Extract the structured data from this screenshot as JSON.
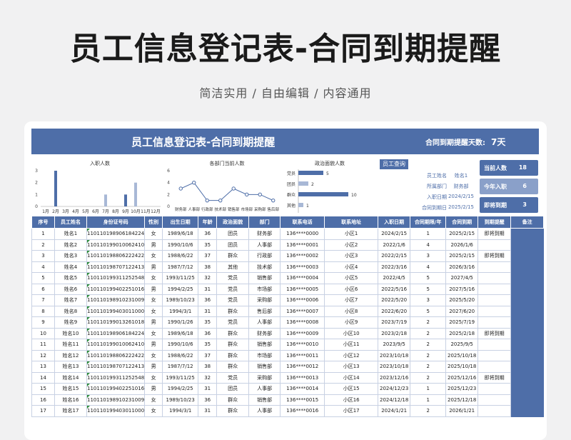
{
  "header": {
    "title": "员工信息登记表-合同到期提醒",
    "subtitle": "简洁实用 / 自由编辑 / 内容通用"
  },
  "sheet": {
    "title": "员工信息登记表-合同到期提醒",
    "reminder_label": "合同到期提醒天数:",
    "reminder_days": "7天"
  },
  "colors": {
    "accent": "#4e6ea8",
    "light_accent": "#8aa0c9",
    "bar_light": "#a8b8d6"
  },
  "chart_data": [
    {
      "type": "bar",
      "title": "入职人数",
      "categories": [
        "1月",
        "2月",
        "3月",
        "4月",
        "5月",
        "6月",
        "7月",
        "8月",
        "9月",
        "10月",
        "11月",
        "12月"
      ],
      "values": [
        0,
        3,
        0,
        0,
        0,
        0,
        1,
        0,
        1,
        2,
        0,
        0
      ],
      "ylim": [
        0,
        3
      ],
      "yticks": [
        "0",
        "1",
        "2",
        "3"
      ]
    },
    {
      "type": "line",
      "title": "各部门当前人数",
      "categories": [
        "财务部",
        "人事部",
        "行政部",
        "技术部",
        "销售部",
        "市场部",
        "采购部",
        "售后部"
      ],
      "values": [
        3,
        4,
        1,
        1,
        3,
        2,
        2,
        1
      ],
      "ylim": [
        0,
        6
      ],
      "yticks": [
        "0",
        "2",
        "4",
        "6"
      ]
    },
    {
      "type": "bar",
      "orientation": "horizontal",
      "title": "政治面貌人数",
      "categories": [
        "党员",
        "团员",
        "群众",
        "其他"
      ],
      "values": [
        5,
        2,
        10,
        1
      ]
    }
  ],
  "query": {
    "button": "员工查询",
    "rows": [
      {
        "label": "员工姓名",
        "value": "姓名1"
      },
      {
        "label": "所属部门",
        "value": "财务部"
      },
      {
        "label": "入职日期",
        "value": "2024/2/15"
      },
      {
        "label": "合同到期日",
        "value": "2025/2/15"
      }
    ]
  },
  "stats": [
    {
      "label": "当前人数",
      "value": "18"
    },
    {
      "label": "今年入职",
      "value": "6"
    },
    {
      "label": "即将到期",
      "value": "3"
    }
  ],
  "table": {
    "headers": [
      "序号",
      "员工姓名",
      "身份证号码",
      "性别",
      "出生日期",
      "年龄",
      "政治面貌",
      "部门",
      "联系电话",
      "联系地址",
      "入职日期",
      "合同期限/年",
      "合同到期",
      "到期提醒",
      "备注"
    ],
    "rows": [
      [
        "1",
        "姓名1",
        "11011019890618​4224",
        "女",
        "1989/6/18",
        "36",
        "团员",
        "财务部",
        "136****0000",
        "小区1",
        "2024/2/15",
        "1",
        "2025/2/15",
        "即将到期",
        ""
      ],
      [
        "2",
        "姓名2",
        "11011019901006​2410",
        "男",
        "1990/10/6",
        "35",
        "团员",
        "人事部",
        "136****0001",
        "小区2",
        "2022/1/6",
        "4",
        "2026/1/6",
        "",
        ""
      ],
      [
        "3",
        "姓名3",
        "11011019880622​2422",
        "女",
        "1988/6/22",
        "37",
        "群众",
        "行政部",
        "136****0002",
        "小区3",
        "2022/2/15",
        "3",
        "2025/2/15",
        "即将到期",
        ""
      ],
      [
        "4",
        "姓名4",
        "11011019870712​2413",
        "男",
        "1987/7/12",
        "38",
        "其他",
        "技术部",
        "136****0003",
        "小区4",
        "2022/3/16",
        "4",
        "2026/3/16",
        "",
        ""
      ],
      [
        "5",
        "姓名5",
        "11011019931125​2548",
        "女",
        "1993/11/25",
        "32",
        "党员",
        "销售部",
        "136****0004",
        "小区5",
        "2022/4/5",
        "5",
        "2027/4/5",
        "",
        ""
      ],
      [
        "6",
        "姓名6",
        "11011019940225​1016",
        "男",
        "1994/2/25",
        "31",
        "党员",
        "市场部",
        "136****0005",
        "小区6",
        "2022/5/16",
        "5",
        "2027/5/16",
        "",
        ""
      ],
      [
        "7",
        "姓名7",
        "11011019891023​1009",
        "女",
        "1989/10/23",
        "36",
        "党员",
        "采购部",
        "136****0006",
        "小区7",
        "2022/5/20",
        "3",
        "2025/5/20",
        "",
        ""
      ],
      [
        "8",
        "姓名8",
        "11011019940301​1000",
        "女",
        "1994/3/1",
        "31",
        "群众",
        "售后部",
        "136****0007",
        "小区8",
        "2022/6/20",
        "5",
        "2027/6/20",
        "",
        ""
      ],
      [
        "9",
        "姓名9",
        "11011019901326​1018",
        "男",
        "1990/1/26",
        "35",
        "党员",
        "人事部",
        "136****0008",
        "小区9",
        "2023/7/19",
        "2",
        "2025/7/19",
        "",
        ""
      ],
      [
        "10",
        "姓名10",
        "11011019890618​4224",
        "女",
        "1989/6/18",
        "36",
        "群众",
        "财务部",
        "136****0009",
        "小区10",
        "2023/2/18",
        "2",
        "2025/2/18",
        "即将到期",
        ""
      ],
      [
        "11",
        "姓名11",
        "11011019901006​2410",
        "男",
        "1990/10/6",
        "35",
        "群众",
        "销售部",
        "136****0010",
        "小区11",
        "2023/9/5",
        "2",
        "2025/9/5",
        "",
        ""
      ],
      [
        "12",
        "姓名12",
        "11011019880622​2422",
        "女",
        "1988/6/22",
        "37",
        "群众",
        "市场部",
        "136****0011",
        "小区12",
        "2023/10/18",
        "2",
        "2025/10/18",
        "",
        ""
      ],
      [
        "13",
        "姓名13",
        "11011019870712​2413",
        "男",
        "1987/7/12",
        "38",
        "群众",
        "销售部",
        "136****0012",
        "小区13",
        "2023/10/18",
        "2",
        "2025/10/18",
        "",
        ""
      ],
      [
        "14",
        "姓名14",
        "11011019931125​2548",
        "女",
        "1993/11/25",
        "32",
        "党员",
        "采购部",
        "136****0013",
        "小区14",
        "2023/12/16",
        "2",
        "2025/12/16",
        "即将到期",
        ""
      ],
      [
        "15",
        "姓名15",
        "11011019940225​1016",
        "男",
        "1994/2/25",
        "31",
        "团员",
        "人事部",
        "136****0014",
        "小区15",
        "2024/12/23",
        "1",
        "2025/12/23",
        "",
        ""
      ],
      [
        "16",
        "姓名16",
        "11011019891023​1009",
        "女",
        "1989/10/23",
        "36",
        "群众",
        "销售部",
        "136****0015",
        "小区16",
        "2024/12/18",
        "1",
        "2025/12/18",
        "",
        ""
      ],
      [
        "17",
        "姓名17",
        "11011019940301​1000",
        "女",
        "1994/3/1",
        "31",
        "群众",
        "人事部",
        "136****0016",
        "小区17",
        "2024/1/21",
        "2",
        "2026/1/21",
        "",
        ""
      ]
    ]
  }
}
